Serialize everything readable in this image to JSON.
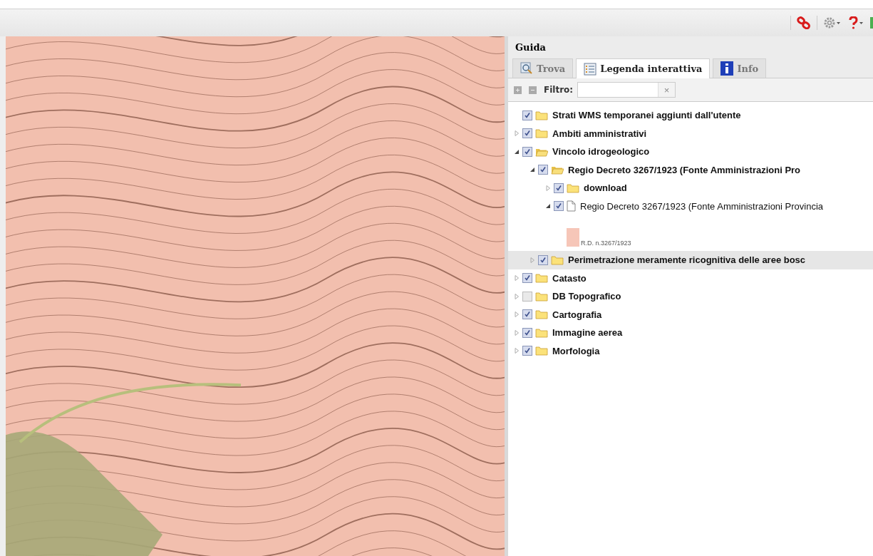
{
  "panel": {
    "title": "Guida",
    "tabs": [
      {
        "label": "Trova",
        "selected": false
      },
      {
        "label": "Legenda interattiva",
        "selected": true
      },
      {
        "label": "Info",
        "selected": false
      }
    ],
    "filter": {
      "label": "Filtro:",
      "clear": "×"
    }
  },
  "tree": [
    {
      "kind": "folder",
      "label": "Strati WMS temporanei aggiunti dall'utente",
      "checked": true,
      "selected": false
    },
    {
      "kind": "folder",
      "label": "Ambiti amministrativi",
      "checked": true,
      "expanded": false,
      "selected": false
    },
    {
      "kind": "folder",
      "label": "Vincolo idrogeologico",
      "checked": true,
      "expanded": true,
      "selected": false,
      "children": [
        {
          "kind": "folder",
          "label": "Regio Decreto 3267/1923 (Fonte Amministrazioni Pro",
          "checked": true,
          "expanded": true,
          "selected": false,
          "children": [
            {
              "kind": "folder",
              "label": "download",
              "checked": true,
              "expanded": false,
              "selected": false
            },
            {
              "kind": "layer",
              "label": "Regio Decreto 3267/1923 (Fonte Amministrazioni Provincia",
              "checked": true,
              "expanded": true,
              "selected": false,
              "children": [
                {
                  "kind": "legend",
                  "label": "R.D. n.3267/1923",
                  "color": "#f6c6b8"
                }
              ]
            }
          ]
        },
        {
          "kind": "folder",
          "label": "Perimetrazione meramente ricognitiva delle aree bosc",
          "checked": true,
          "expanded": false,
          "selected": true
        }
      ]
    },
    {
      "kind": "folder",
      "label": "Catasto",
      "checked": true,
      "expanded": false,
      "selected": false
    },
    {
      "kind": "folder",
      "label": "DB Topografico",
      "checked": false,
      "expanded": false,
      "selected": false
    },
    {
      "kind": "folder",
      "label": "Cartografia",
      "checked": true,
      "expanded": false,
      "selected": false
    },
    {
      "kind": "folder",
      "label": "Immagine aerea",
      "checked": true,
      "expanded": false,
      "selected": false
    },
    {
      "kind": "folder",
      "label": "Morfologia",
      "checked": true,
      "expanded": false,
      "selected": false
    }
  ]
}
